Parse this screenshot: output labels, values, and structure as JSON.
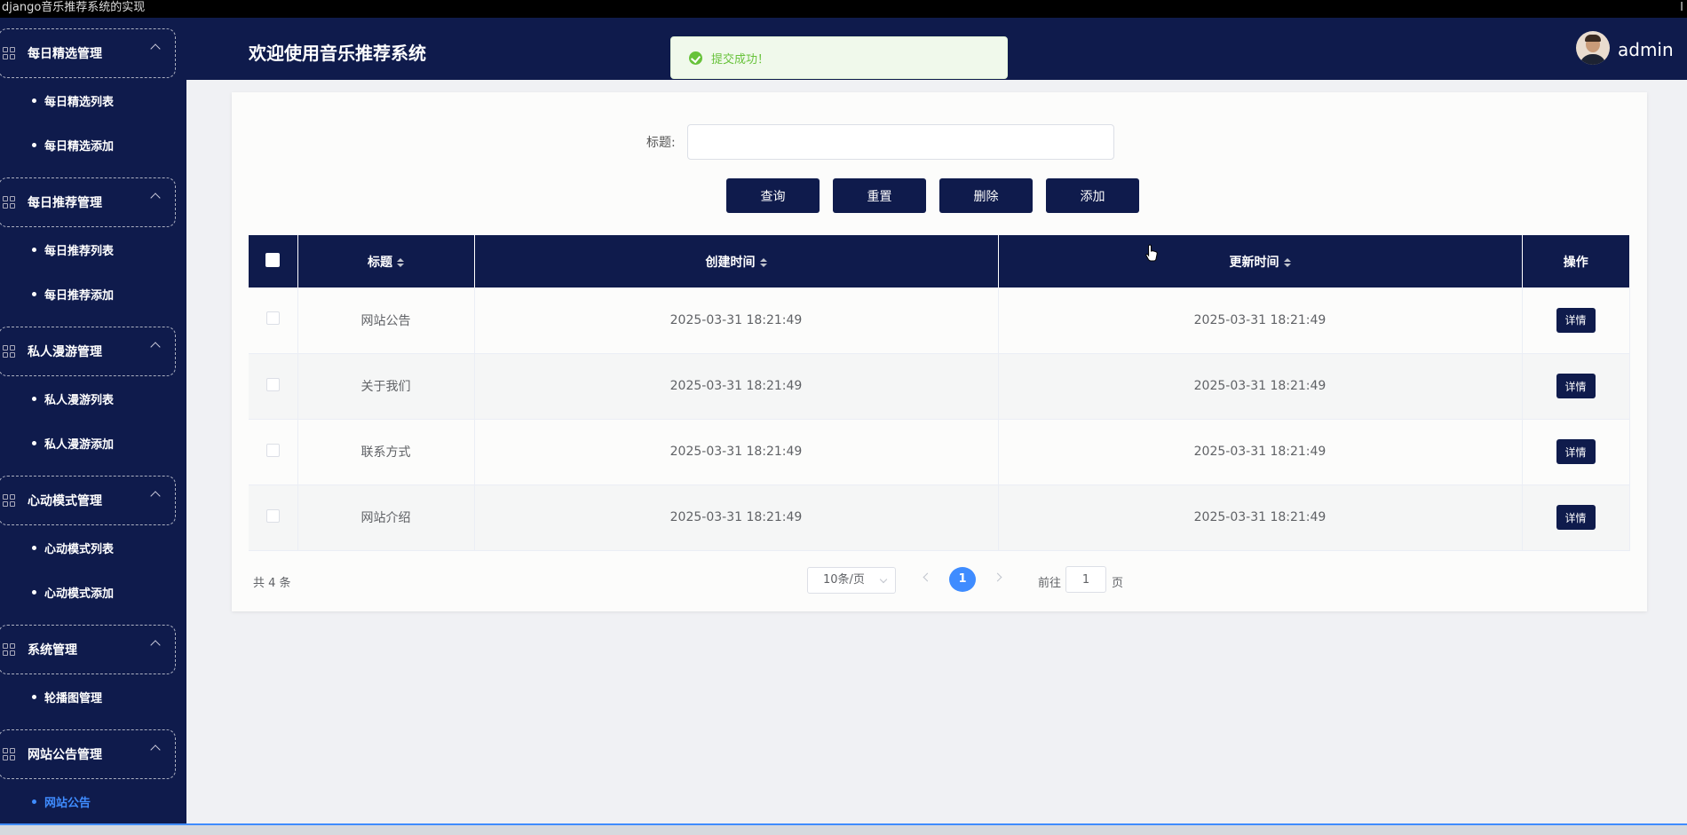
{
  "window": {
    "title": "django音乐推荐系统的实现",
    "right_text": "I"
  },
  "header": {
    "welcome": "欢迎使用音乐推荐系统",
    "username": "admin"
  },
  "toast": {
    "message": "提交成功！"
  },
  "sidebar": {
    "groups": [
      {
        "label": "每日精选管理",
        "items": [
          "每日精选列表",
          "每日精选添加"
        ]
      },
      {
        "label": "每日推荐管理",
        "items": [
          "每日推荐列表",
          "每日推荐添加"
        ]
      },
      {
        "label": "私人漫游管理",
        "items": [
          "私人漫游列表",
          "私人漫游添加"
        ]
      },
      {
        "label": "心动模式管理",
        "items": [
          "心动模式列表",
          "心动模式添加"
        ]
      },
      {
        "label": "系统管理",
        "items": [
          "轮播图管理"
        ]
      },
      {
        "label": "网站公告管理",
        "items": [
          "网站公告"
        ]
      }
    ],
    "active_item": "网站公告"
  },
  "search": {
    "label": "标题:",
    "value": ""
  },
  "buttons": {
    "query": "查询",
    "reset": "重置",
    "delete": "删除",
    "add": "添加"
  },
  "table": {
    "columns": {
      "title": "标题",
      "created": "创建时间",
      "updated": "更新时间",
      "actions": "操作"
    },
    "rows": [
      {
        "title": "网站公告",
        "created": "2025-03-31 18:21:49",
        "updated": "2025-03-31 18:21:49",
        "action": "详情"
      },
      {
        "title": "关于我们",
        "created": "2025-03-31 18:21:49",
        "updated": "2025-03-31 18:21:49",
        "action": "详情"
      },
      {
        "title": "联系方式",
        "created": "2025-03-31 18:21:49",
        "updated": "2025-03-31 18:21:49",
        "action": "详情"
      },
      {
        "title": "网站介绍",
        "created": "2025-03-31 18:21:49",
        "updated": "2025-03-31 18:21:49",
        "action": "详情"
      }
    ]
  },
  "pagination": {
    "total": "共 4 条",
    "page_size": "10条/页",
    "current_page": "1",
    "goto_label": "前往",
    "goto_value": "1",
    "page_label": "页"
  },
  "colors": {
    "primary": "#0f1b4c",
    "accent": "#3f8cff",
    "success": "#67c23a"
  }
}
